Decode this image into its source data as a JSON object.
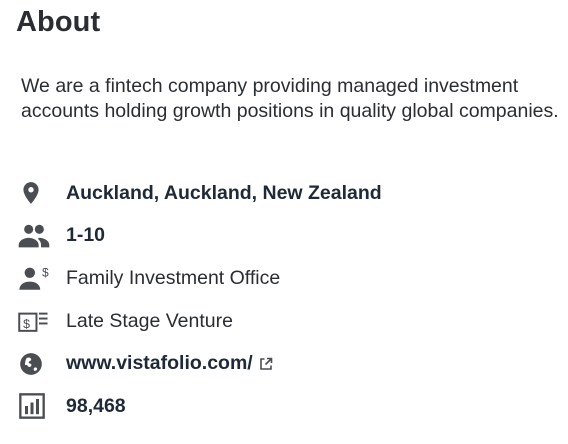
{
  "section": {
    "title": "About",
    "description": "We are a fintech company providing managed investment accounts holding growth positions in quality global companies."
  },
  "details": {
    "location": {
      "text": "Auckland, Auckland, New Zealand",
      "icon": "location-pin-icon"
    },
    "employees": {
      "text": "1-10",
      "icon": "people-icon"
    },
    "investor_type": {
      "text": "Family Investment Office",
      "icon": "person-dollar-icon"
    },
    "stage": {
      "text": "Late Stage Venture",
      "icon": "money-list-icon"
    },
    "website": {
      "text": "www.vistafolio.com/",
      "icon": "globe-icon",
      "external_icon": "external-link-icon"
    },
    "rank": {
      "text": "98,468",
      "icon": "bar-chart-icon"
    }
  },
  "colors": {
    "text": "#2a2d31",
    "icon": "#4a4d52"
  }
}
